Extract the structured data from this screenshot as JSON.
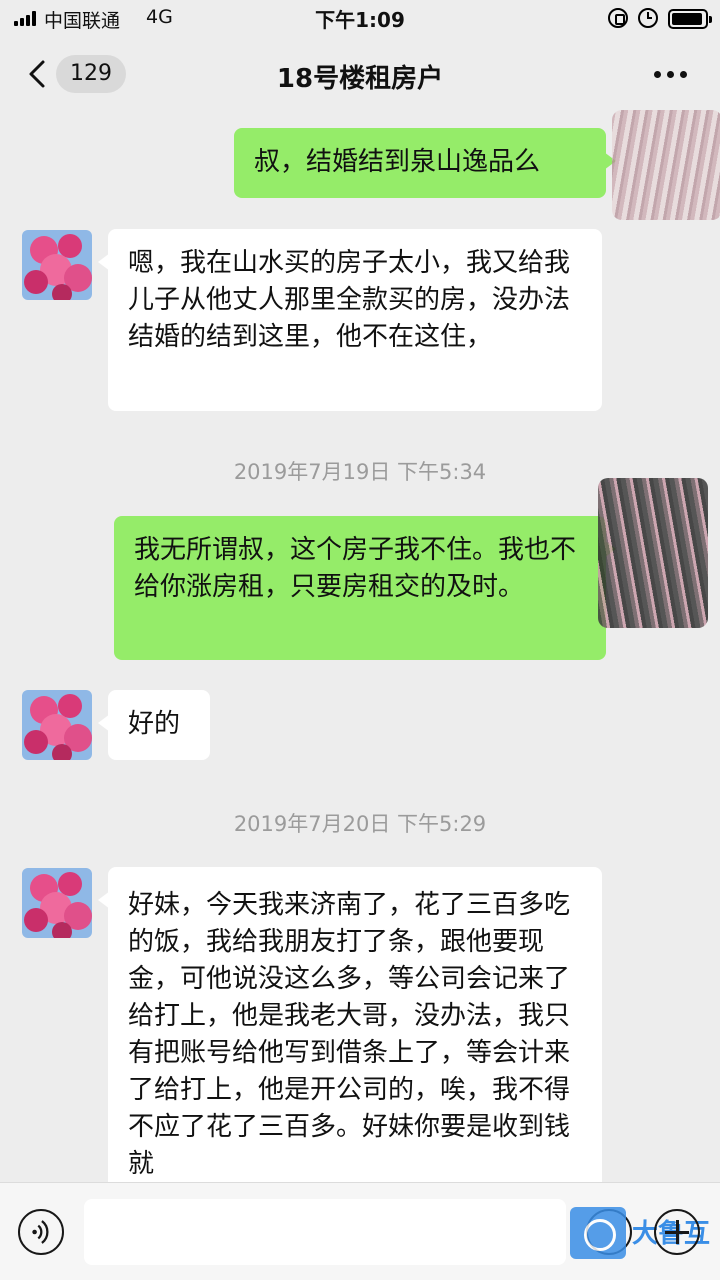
{
  "status_bar": {
    "carrier": "中国联通",
    "network": "4G",
    "time": "下午1:09",
    "icons": [
      "signal-icon",
      "rotation-lock-icon",
      "alarm-icon",
      "battery-icon"
    ]
  },
  "nav": {
    "unread_count": "129",
    "title": "18号楼租房户",
    "icons": [
      "chevron-left-icon",
      "more-icon"
    ]
  },
  "messages": [
    {
      "side": "sent",
      "text": "叔，结婚结到泉山逸品么"
    },
    {
      "side": "received",
      "text": "嗯，我在山水买的房子太小，我又给我儿子从他丈人那里全款买的房，没办法结婚的结到这里，他不在这住，"
    },
    {
      "type": "timestamp",
      "text": "2019年7月19日 下午5:34"
    },
    {
      "side": "sent",
      "text": "我无所谓叔，这个房子我不住。我也不给你涨房租，只要房租交的及时。"
    },
    {
      "side": "received",
      "text": "好的"
    },
    {
      "type": "timestamp",
      "text": "2019年7月20日 下午5:29"
    },
    {
      "side": "received",
      "text": "好妹，今天我来济南了，花了三百多吃的饭，我给我朋友打了条，跟他要现金，可他说没这么多，等公司会记来了给打上，他是我老大哥，没办法，我只有把账号给他写到借条上了，等会计来了给打上，他是开公司的，唉，我不得不应了花了三百多。好妹你要是收到钱就"
    }
  ],
  "input_bar": {
    "message_input_value": "",
    "icons": [
      "voice-icon",
      "emoji-icon",
      "plus-icon"
    ]
  },
  "watermark": {
    "text": "大鲁互"
  },
  "colors": {
    "background": "#ededed",
    "sent_bubble": "#95ec69",
    "received_bubble": "#ffffff",
    "timestamp_text": "#9b9b9b",
    "watermark_blue": "#3a8ee6"
  }
}
